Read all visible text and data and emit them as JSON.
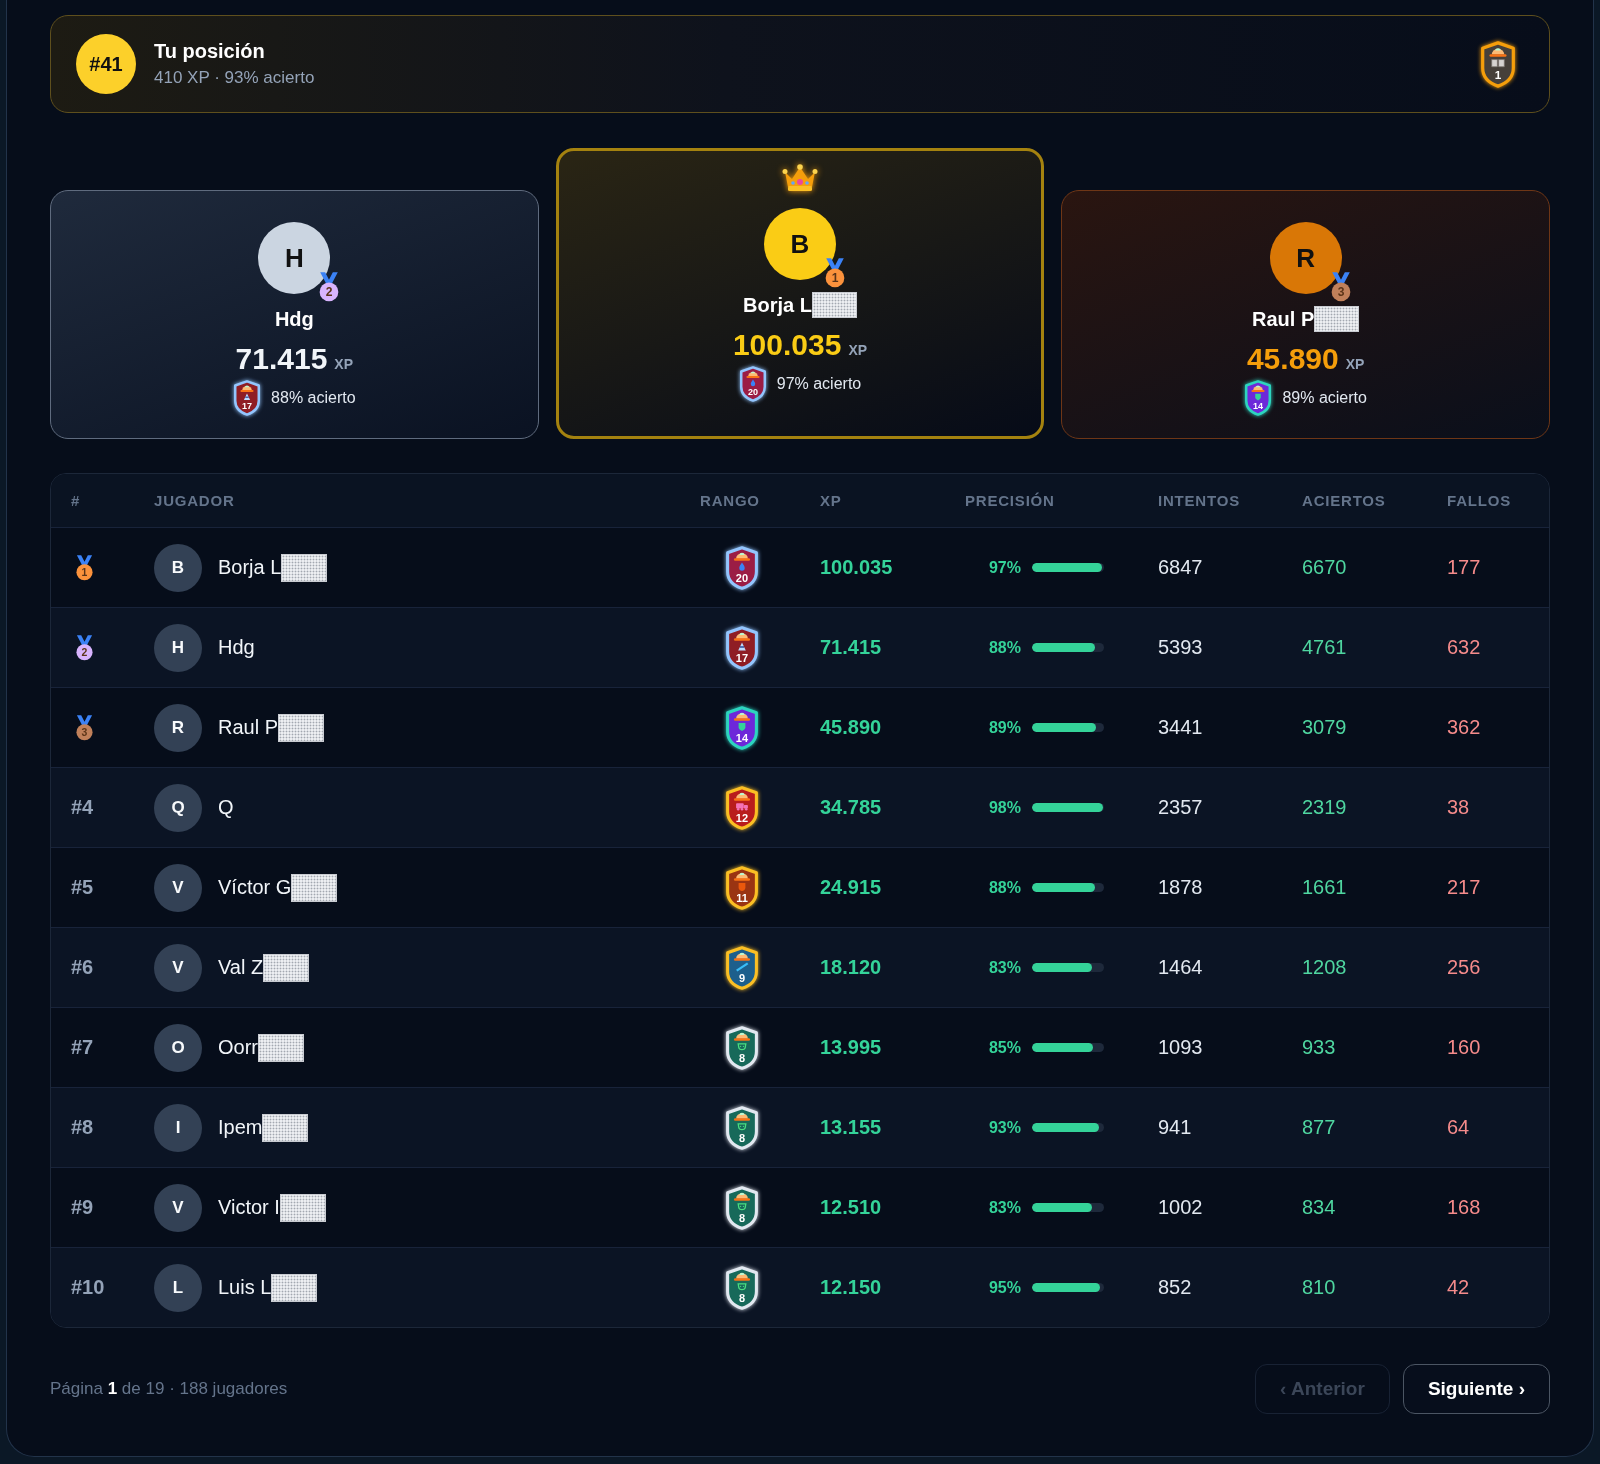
{
  "my_position": {
    "rank": "#41",
    "title": "Tu posición",
    "summary": "410 XP · 93% acierto",
    "badge": {
      "label": "1",
      "kind": "book",
      "color": "#46403a",
      "frame": {
        "color": "#f59e0b"
      }
    }
  },
  "podium": [
    {
      "kind": "second",
      "crown": false,
      "initial": "H",
      "name": "Hdg",
      "redacted": false,
      "medal": {
        "label": "2",
        "color": "#d8b4fe"
      },
      "xp": "71.415",
      "xp_unit": "XP",
      "badge": {
        "label": "17",
        "kind": "cone",
        "color": "#8f1d24",
        "frame": {
          "color": "#93c5fd"
        }
      },
      "accuracy": "88% acierto"
    },
    {
      "kind": "first",
      "crown": true,
      "initial": "B",
      "name": "Borja L",
      "redacted": true,
      "medal": {
        "label": "1",
        "color": "#fb923c"
      },
      "xp": "100.035",
      "xp_unit": "XP",
      "badge": {
        "label": "20",
        "kind": "drop",
        "color": "#9b1d45",
        "frame": {
          "color": "#93c5fd"
        }
      },
      "accuracy": "97% acierto"
    },
    {
      "kind": "third",
      "crown": false,
      "initial": "R",
      "name": "Raul P",
      "redacted": true,
      "medal": {
        "label": "3",
        "color": "#c0805a"
      },
      "xp": "45.890",
      "xp_unit": "XP",
      "badge": {
        "label": "14",
        "kind": "shield",
        "color": "#6d28d9",
        "frame": {
          "color": "#2dd4bf"
        }
      },
      "accuracy": "89% acierto"
    }
  ],
  "table": {
    "columns": [
      "#",
      "JUGADOR",
      "RANGO",
      "XP",
      "PRECISIÓN",
      "INTENTOS",
      "ACIERTOS",
      "FALLOS"
    ],
    "rows": [
      {
        "position": {
          "kind": "medal",
          "label": "1",
          "color": "#fb923c"
        },
        "initial": "B",
        "name": "Borja L",
        "redacted": true,
        "rank": {
          "label": "20",
          "kind": "drop",
          "color": "#9b1d45",
          "frame": {
            "color": "#93c5fd"
          }
        },
        "xp": "100.035",
        "precision": "97%",
        "level": 0.97,
        "attempts": "6847",
        "correct": "6670",
        "misses": "177"
      },
      {
        "position": {
          "kind": "medal",
          "label": "2",
          "color": "#d8b4fe"
        },
        "initial": "H",
        "name": "Hdg",
        "redacted": false,
        "rank": {
          "label": "17",
          "kind": "cone",
          "color": "#8f1d24",
          "frame": {
            "color": "#93c5fd"
          }
        },
        "xp": "71.415",
        "precision": "88%",
        "level": 0.88,
        "attempts": "5393",
        "correct": "4761",
        "misses": "632"
      },
      {
        "position": {
          "kind": "medal",
          "label": "3",
          "color": "#c0805a"
        },
        "initial": "R",
        "name": "Raul P",
        "redacted": true,
        "rank": {
          "label": "14",
          "kind": "shield",
          "color": "#6d28d9",
          "frame": {
            "color": "#2dd4bf"
          }
        },
        "xp": "45.890",
        "precision": "89%",
        "level": 0.89,
        "attempts": "3441",
        "correct": "3079",
        "misses": "362"
      },
      {
        "position": {
          "kind": "text",
          "label": "#4"
        },
        "initial": "Q",
        "name": "Q",
        "redacted": false,
        "rank": {
          "label": "12",
          "kind": "truck",
          "color": "#b91c1c",
          "frame": {
            "color": "#fbbf24"
          }
        },
        "xp": "34.785",
        "precision": "98%",
        "level": 0.98,
        "attempts": "2357",
        "correct": "2319",
        "misses": "38"
      },
      {
        "position": {
          "kind": "text",
          "label": "#5"
        },
        "initial": "V",
        "name": "Víctor G",
        "redacted": true,
        "rank": {
          "label": "11",
          "kind": "plate",
          "color": "#9a3412",
          "frame": {
            "color": "#fbbf24"
          }
        },
        "xp": "24.915",
        "precision": "88%",
        "level": 0.88,
        "attempts": "1878",
        "correct": "1661",
        "misses": "217"
      },
      {
        "position": {
          "kind": "text",
          "label": "#6"
        },
        "initial": "V",
        "name": "Val Z",
        "redacted": true,
        "rank": {
          "label": "9",
          "kind": "stripe",
          "color": "#1d5f8c",
          "frame": {
            "color": "#fbbf24"
          }
        },
        "xp": "18.120",
        "precision": "83%",
        "level": 0.83,
        "attempts": "1464",
        "correct": "1208",
        "misses": "256"
      },
      {
        "position": {
          "kind": "text",
          "label": "#7"
        },
        "initial": "O",
        "name": "Oorr",
        "redacted": true,
        "rank": {
          "label": "8",
          "kind": "pot",
          "color": "#17695a",
          "frame": {
            "color": "#e2e8f0"
          }
        },
        "xp": "13.995",
        "precision": "85%",
        "level": 0.85,
        "attempts": "1093",
        "correct": "933",
        "misses": "160"
      },
      {
        "position": {
          "kind": "text",
          "label": "#8"
        },
        "initial": "I",
        "name": "Ipem",
        "redacted": true,
        "rank": {
          "label": "8",
          "kind": "pot",
          "color": "#17695a",
          "frame": {
            "color": "#e2e8f0"
          }
        },
        "xp": "13.155",
        "precision": "93%",
        "level": 0.93,
        "attempts": "941",
        "correct": "877",
        "misses": "64"
      },
      {
        "position": {
          "kind": "text",
          "label": "#9"
        },
        "initial": "V",
        "name": "Victor I",
        "redacted": true,
        "rank": {
          "label": "8",
          "kind": "pot",
          "color": "#17695a",
          "frame": {
            "color": "#e2e8f0"
          }
        },
        "xp": "12.510",
        "precision": "83%",
        "level": 0.83,
        "attempts": "1002",
        "correct": "834",
        "misses": "168"
      },
      {
        "position": {
          "kind": "text",
          "label": "#10"
        },
        "initial": "L",
        "name": "Luis L",
        "redacted": true,
        "rank": {
          "label": "8",
          "kind": "pot",
          "color": "#17695a",
          "frame": {
            "color": "#e2e8f0"
          }
        },
        "xp": "12.150",
        "precision": "95%",
        "level": 0.95,
        "attempts": "852",
        "correct": "810",
        "misses": "42"
      }
    ]
  },
  "pagination": {
    "summary": "Página **1** de 19 · 188 jugadores",
    "buttons": [
      {
        "label": "‹ Anterior",
        "disabled": true
      },
      {
        "label": "Siguiente ›",
        "disabled": false
      }
    ]
  }
}
